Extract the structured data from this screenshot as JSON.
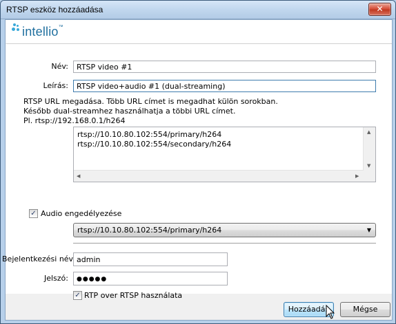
{
  "window": {
    "title": "RTSP eszköz hozzáadása",
    "close_symbol": "✕"
  },
  "brand": {
    "logo_text": "intellio",
    "logo_mark": "™",
    "accent": "#39a9d9"
  },
  "form": {
    "name_label": "Név:",
    "name_value": "RTSP video #1",
    "description_label": "Leírás:",
    "description_value": "RTSP video+audio #1 (dual-streaming)",
    "hint_lines": [
      "RTSP URL megadása. Több URL címet is megadhat külön sorokban.",
      "Később dual-streamhez használhatja a többi URL címet.",
      "Pl. rtsp://192.168.0.1/h264"
    ],
    "url_lines": [
      "rtsp://10.10.80.102:554/primary/h264",
      "rtsp://10.10.80.102:554/secondary/h264"
    ],
    "audio_checkbox_label": "Audio engedélyezése",
    "audio_checked": true,
    "audio_stream_value": "rtsp://10.10.80.102:554/primary/h264",
    "login_label": "Bejelentkezési név:",
    "login_value": "admin",
    "password_label": "Jelszó:",
    "password_mask": "●●●●●",
    "rtp_checkbox_label": "RTP over RTSP használata",
    "rtp_checked": true,
    "check_mark": "✓"
  },
  "buttons": {
    "add_label": "Hozzáadás",
    "cancel_label": "Mégse"
  }
}
